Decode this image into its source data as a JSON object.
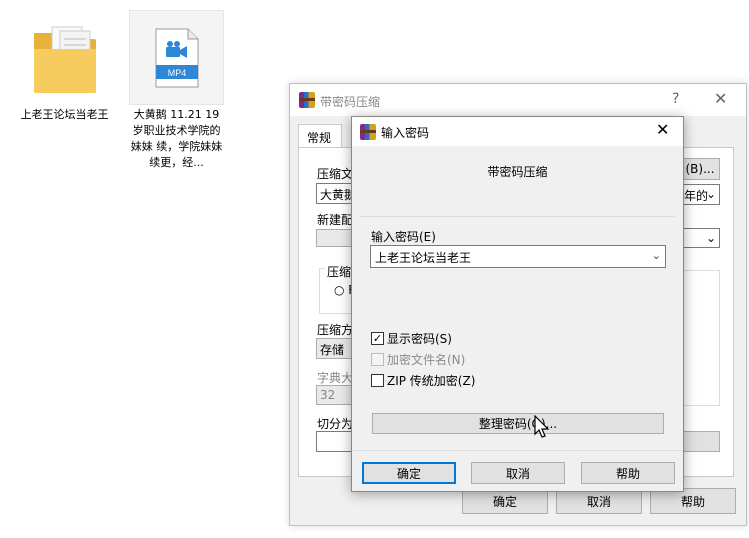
{
  "desktop": {
    "folder": {
      "icon": "folder-icon",
      "label": "上老王论坛当老王"
    },
    "video": {
      "icon": "video-file-icon",
      "badge": "MP4",
      "label": "大黄鹅 11.21 19岁职业技术学院的妹妹 续，学院妹妹续更，经..."
    }
  },
  "background_dialog": {
    "title": "带密码压缩",
    "help_glyph": "?",
    "close_glyph": "✕",
    "tab": "常规",
    "labels": {
      "archive_name": "压缩文",
      "archive_value": "大黄鹅",
      "browse": "(B)...",
      "update_mode": "年的",
      "profile": "新建配",
      "format": "压缩",
      "radio": "R",
      "method": "压缩方",
      "method_value": "存储",
      "dict": "字典大",
      "dict_value": "32",
      "split": "切分为"
    },
    "buttons": {
      "ok": "确定",
      "cancel": "取消",
      "help": "帮助"
    }
  },
  "password_dialog": {
    "title": "输入密码",
    "close_glyph": "✕",
    "heading": "带密码压缩",
    "field_label": "输入密码(E)",
    "password_value": "上老王论坛当老王",
    "options": [
      {
        "label": "显示密码(S)",
        "checked": true,
        "enabled": true
      },
      {
        "label": "加密文件名(N)",
        "checked": false,
        "enabled": false
      },
      {
        "label": "ZIP 传统加密(Z)",
        "checked": false,
        "enabled": true
      }
    ],
    "manage_button": "整理密码(O)...",
    "buttons": {
      "ok": "确定",
      "cancel": "取消",
      "help": "帮助"
    }
  }
}
